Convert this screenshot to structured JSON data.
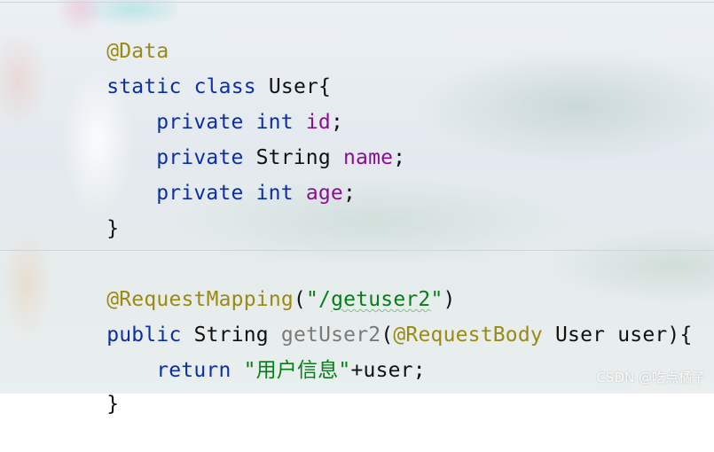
{
  "editor": {
    "block1": {
      "annotation": "@Data",
      "class_decl": {
        "kw1": "static",
        "kw2": "class",
        "name": "User",
        "brace": "{"
      },
      "fields": [
        {
          "modifier": "private",
          "type": "int",
          "name": "id",
          "end": ";"
        },
        {
          "modifier": "private",
          "type": "String",
          "name": "name",
          "end": ";"
        },
        {
          "modifier": "private",
          "type": "int",
          "name": "age",
          "end": ";"
        }
      ],
      "close": "}"
    },
    "block2": {
      "annotation_name": "@RequestMapping",
      "paren_open": "(",
      "path_quote_open": "\"/",
      "path": "getuser2",
      "path_quote_close": "\"",
      "paren_close": ")",
      "method_decl": {
        "kw": "public",
        "return_type": "String",
        "name": "getUser2",
        "paren_open": "(",
        "param_annotation": "@RequestBody",
        "param": " User user){"
      },
      "return_stmt": {
        "kw": "return",
        "string": "\"用户信息\"",
        "rest": "+user;"
      },
      "close": "}"
    }
  },
  "watermark": "CSDN @吃点橘子"
}
